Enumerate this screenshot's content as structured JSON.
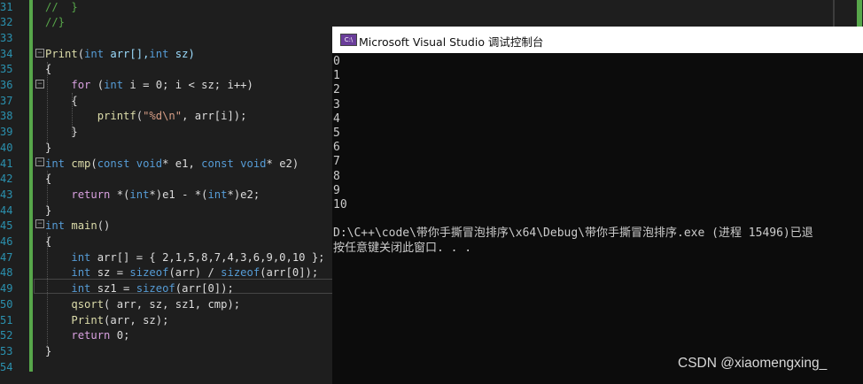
{
  "editor": {
    "line_numbers": [
      "31",
      "32",
      "33",
      "34",
      "35",
      "36",
      "37",
      "38",
      "39",
      "40",
      "41",
      "42",
      "43",
      "44",
      "45",
      "46",
      "47",
      "48",
      "49",
      "50",
      "51",
      "52",
      "53",
      "54"
    ],
    "lines": [
      [
        {
          "t": "//  }",
          "c": "#57a64a"
        }
      ],
      [
        {
          "t": "//}",
          "c": "#57a64a"
        }
      ],
      [],
      [
        {
          "t": "Print",
          "c": "#dcdcaa"
        },
        {
          "t": "(",
          "c": "#dcdcdc"
        },
        {
          "t": "int",
          "c": "#569cd6"
        },
        {
          "t": " arr[],",
          "c": "#9cdcfe"
        },
        {
          "t": "int",
          "c": "#569cd6"
        },
        {
          "t": " sz)",
          "c": "#9cdcfe"
        }
      ],
      [
        {
          "t": "{",
          "c": "#dcdcdc"
        }
      ],
      [
        {
          "t": "    "
        },
        {
          "t": "for",
          "c": "#d8a0df"
        },
        {
          "t": " (",
          "c": "#dcdcdc"
        },
        {
          "t": "int",
          "c": "#569cd6"
        },
        {
          "t": " i = 0; i < sz; i++)",
          "c": "#dcdcdc"
        }
      ],
      [
        {
          "t": "    {",
          "c": "#dcdcdc"
        }
      ],
      [
        {
          "t": "        "
        },
        {
          "t": "printf",
          "c": "#dcdcaa"
        },
        {
          "t": "(",
          "c": "#dcdcdc"
        },
        {
          "t": "\"%d\\n\"",
          "c": "#d69d85"
        },
        {
          "t": ", arr[i]);",
          "c": "#dcdcdc"
        }
      ],
      [
        {
          "t": "    }",
          "c": "#dcdcdc"
        }
      ],
      [
        {
          "t": "}",
          "c": "#dcdcdc"
        }
      ],
      [
        {
          "t": "int",
          "c": "#569cd6"
        },
        {
          "t": " cmp",
          "c": "#dcdcaa"
        },
        {
          "t": "(",
          "c": "#dcdcdc"
        },
        {
          "t": "const",
          "c": "#569cd6"
        },
        {
          "t": " ",
          "c": "#dcdcdc"
        },
        {
          "t": "void",
          "c": "#569cd6"
        },
        {
          "t": "* e1, ",
          "c": "#dcdcdc"
        },
        {
          "t": "const",
          "c": "#569cd6"
        },
        {
          "t": " ",
          "c": "#dcdcdc"
        },
        {
          "t": "void",
          "c": "#569cd6"
        },
        {
          "t": "* e2)",
          "c": "#dcdcdc"
        }
      ],
      [
        {
          "t": "{",
          "c": "#dcdcdc"
        }
      ],
      [
        {
          "t": "    "
        },
        {
          "t": "return",
          "c": "#d8a0df"
        },
        {
          "t": " *(",
          "c": "#dcdcdc"
        },
        {
          "t": "int",
          "c": "#569cd6"
        },
        {
          "t": "*)e1 - *(",
          "c": "#dcdcdc"
        },
        {
          "t": "int",
          "c": "#569cd6"
        },
        {
          "t": "*)e2;",
          "c": "#dcdcdc"
        }
      ],
      [
        {
          "t": "}",
          "c": "#dcdcdc"
        }
      ],
      [
        {
          "t": "int",
          "c": "#569cd6"
        },
        {
          "t": " main",
          "c": "#dcdcaa"
        },
        {
          "t": "()",
          "c": "#dcdcdc"
        }
      ],
      [
        {
          "t": "{",
          "c": "#dcdcdc"
        }
      ],
      [
        {
          "t": "    "
        },
        {
          "t": "int",
          "c": "#569cd6"
        },
        {
          "t": " arr[] = { 2,1,5,8,7,4,3,6,9,0,10 };",
          "c": "#dcdcdc"
        }
      ],
      [
        {
          "t": "    "
        },
        {
          "t": "int",
          "c": "#569cd6"
        },
        {
          "t": " sz = ",
          "c": "#dcdcdc"
        },
        {
          "t": "sizeof",
          "c": "#569cd6"
        },
        {
          "t": "(arr) / ",
          "c": "#dcdcdc"
        },
        {
          "t": "sizeof",
          "c": "#569cd6"
        },
        {
          "t": "(arr[0]);",
          "c": "#dcdcdc"
        }
      ],
      [
        {
          "t": "    "
        },
        {
          "t": "int",
          "c": "#569cd6"
        },
        {
          "t": " sz1 = ",
          "c": "#dcdcdc"
        },
        {
          "t": "sizeof",
          "c": "#569cd6"
        },
        {
          "t": "(arr[0]);",
          "c": "#dcdcdc"
        }
      ],
      [
        {
          "t": "    "
        },
        {
          "t": "qsort",
          "c": "#dcdcaa"
        },
        {
          "t": "( arr, sz, sz1, cmp);",
          "c": "#dcdcdc"
        }
      ],
      [
        {
          "t": "    "
        },
        {
          "t": "Print",
          "c": "#dcdcaa"
        },
        {
          "t": "(arr, sz);",
          "c": "#dcdcdc"
        }
      ],
      [
        {
          "t": "    "
        },
        {
          "t": "return",
          "c": "#d8a0df"
        },
        {
          "t": " 0;",
          "c": "#dcdcdc"
        }
      ],
      [
        {
          "t": "}",
          "c": "#dcdcdc"
        }
      ],
      []
    ],
    "colors": {
      "accent_green": "#57a64a",
      "line_number": "#2b91af",
      "background": "#1e1e1e"
    }
  },
  "console": {
    "title": "Microsoft Visual Studio 调试控制台",
    "icon": "visual-studio-icon",
    "output": [
      "0",
      "1",
      "2",
      "3",
      "4",
      "5",
      "6",
      "7",
      "8",
      "9",
      "10",
      "",
      "D:\\C++\\code\\带你手撕冒泡排序\\x64\\Debug\\带你手撕冒泡排序.exe (进程 15496)已退",
      "按任意键关闭此窗口. . ."
    ]
  },
  "watermark": "CSDN @xiaomengxing_"
}
